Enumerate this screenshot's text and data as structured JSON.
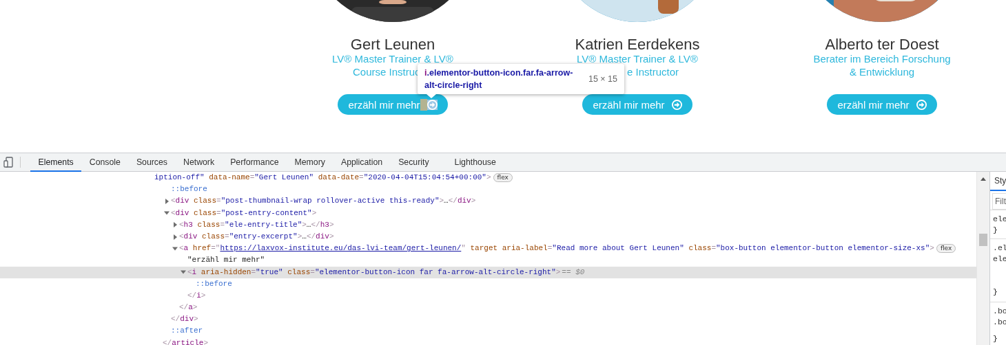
{
  "team": [
    {
      "name": "Gert Leunen",
      "role_lines": [
        {
          "text": "LV® Master Trainer & LV®",
          "kind": "whole"
        },
        {
          "text": "Course Instruc",
          "kind": "cut-end"
        }
      ],
      "button": {
        "label": "erzähl mir mehr",
        "inspected": true
      }
    },
    {
      "name": "Katrien Eerdekens",
      "role_lines": [
        {
          "text": "LV® Master Trainer & LV®",
          "kind": "whole"
        },
        {
          "text": "e Instructor",
          "kind": "cut-start"
        }
      ],
      "button": {
        "label": "erzähl mir mehr",
        "inspected": false
      }
    },
    {
      "name": "Alberto ter Doest",
      "role_lines": [
        {
          "text": "Berater im Bereich Forschung",
          "kind": "whole"
        },
        {
          "text": "& Entwicklung",
          "kind": "whole"
        }
      ],
      "button": {
        "label": "erzähl mir mehr",
        "inspected": false
      }
    }
  ],
  "tooltip": {
    "tag": "i",
    "selector": ".elementor-button-icon.far.fa-arrow-alt-circle-right",
    "size": "15 × 15"
  },
  "devtools": {
    "tabs": [
      {
        "label": "Elements",
        "selected": true
      },
      {
        "label": "Console",
        "selected": false
      },
      {
        "label": "Sources",
        "selected": false
      },
      {
        "label": "Network",
        "selected": false
      },
      {
        "label": "Performance",
        "selected": false
      },
      {
        "label": "Memory",
        "selected": false
      },
      {
        "label": "Application",
        "selected": false
      },
      {
        "label": "Security",
        "selected": false
      },
      {
        "label": "Lighthouse",
        "selected": false
      }
    ],
    "dom": {
      "wrapped": true,
      "selected": false,
      "badge": "flex",
      "tokens": [
        {
          "kind": "value",
          "text": "iption-off\""
        },
        {
          "kind": "attr",
          "text": " data-name"
        },
        {
          "kind": "punct",
          "text": "="
        },
        {
          "kind": "value",
          "text": "\"Gert Leunen\""
        },
        {
          "kind": "attr",
          "text": " data-date"
        },
        {
          "kind": "punct",
          "text": "="
        },
        {
          "kind": "value",
          "text": "\"2020-04-04T15:04:54+00:00\""
        },
        {
          "kind": "punct",
          "text": ">"
        }
      ],
      "children": [
        {
          "selected": false,
          "tokens": [
            {
              "kind": "pseudo",
              "text": "::before"
            }
          ]
        },
        {
          "selected": false,
          "expanded": false,
          "tokens": [
            {
              "kind": "punct",
              "text": "<"
            },
            {
              "kind": "tag",
              "text": "div"
            },
            {
              "kind": "attr",
              "text": " class"
            },
            {
              "kind": "punct",
              "text": "="
            },
            {
              "kind": "value",
              "text": "\"post-thumbnail-wrap rollover-active this-ready\""
            },
            {
              "kind": "punct",
              "text": ">"
            },
            {
              "kind": "text",
              "text": "…"
            },
            {
              "kind": "punct",
              "text": "</"
            },
            {
              "kind": "tag",
              "text": "div"
            },
            {
              "kind": "punct",
              "text": ">"
            }
          ]
        },
        {
          "selected": false,
          "expanded": true,
          "tokens": [
            {
              "kind": "punct",
              "text": "<"
            },
            {
              "kind": "tag",
              "text": "div"
            },
            {
              "kind": "attr",
              "text": " class"
            },
            {
              "kind": "punct",
              "text": "="
            },
            {
              "kind": "value",
              "text": "\"post-entry-content\""
            },
            {
              "kind": "punct",
              "text": ">"
            }
          ],
          "children": [
            {
              "selected": false,
              "expanded": false,
              "tokens": [
                {
                  "kind": "punct",
                  "text": "<"
                },
                {
                  "kind": "tag",
                  "text": "h3"
                },
                {
                  "kind": "attr",
                  "text": " class"
                },
                {
                  "kind": "punct",
                  "text": "="
                },
                {
                  "kind": "value",
                  "text": "\"ele-entry-title\""
                },
                {
                  "kind": "punct",
                  "text": ">"
                },
                {
                  "kind": "text",
                  "text": "…"
                },
                {
                  "kind": "punct",
                  "text": "</"
                },
                {
                  "kind": "tag",
                  "text": "h3"
                },
                {
                  "kind": "punct",
                  "text": ">"
                }
              ]
            },
            {
              "selected": false,
              "expanded": false,
              "tokens": [
                {
                  "kind": "punct",
                  "text": "<"
                },
                {
                  "kind": "tag",
                  "text": "div"
                },
                {
                  "kind": "attr",
                  "text": " class"
                },
                {
                  "kind": "punct",
                  "text": "="
                },
                {
                  "kind": "value",
                  "text": "\"entry-excerpt\""
                },
                {
                  "kind": "punct",
                  "text": ">"
                },
                {
                  "kind": "text",
                  "text": "…"
                },
                {
                  "kind": "punct",
                  "text": "</"
                },
                {
                  "kind": "tag",
                  "text": "div"
                },
                {
                  "kind": "punct",
                  "text": ">"
                }
              ]
            },
            {
              "selected": false,
              "expanded": true,
              "badge": "flex",
              "tokens": [
                {
                  "kind": "punct",
                  "text": "<"
                },
                {
                  "kind": "tag",
                  "text": "a"
                },
                {
                  "kind": "attr",
                  "text": " href"
                },
                {
                  "kind": "punct",
                  "text": "=\""
                },
                {
                  "kind": "link",
                  "text": "https://laxvox-institute.eu/das-lvi-team/gert-leunen/"
                },
                {
                  "kind": "punct",
                  "text": "\""
                },
                {
                  "kind": "attr",
                  "text": " target aria-label"
                },
                {
                  "kind": "punct",
                  "text": "="
                },
                {
                  "kind": "value",
                  "text": "\"Read more about Gert Leunen\""
                },
                {
                  "kind": "attr",
                  "text": " class"
                },
                {
                  "kind": "punct",
                  "text": "="
                },
                {
                  "kind": "value",
                  "text": "\"box-button elementor-button elementor-size-xs\""
                },
                {
                  "kind": "punct",
                  "text": ">"
                }
              ],
              "children": [
                {
                  "selected": false,
                  "tokens": [
                    {
                      "kind": "text",
                      "text": "\"erzähl mir mehr\""
                    }
                  ]
                },
                {
                  "selected": true,
                  "expanded": true,
                  "marker": "== $0",
                  "tokens": [
                    {
                      "kind": "punct",
                      "text": "<"
                    },
                    {
                      "kind": "tag",
                      "text": "i"
                    },
                    {
                      "kind": "attr",
                      "text": " aria-hidden"
                    },
                    {
                      "kind": "punct",
                      "text": "="
                    },
                    {
                      "kind": "value",
                      "text": "\"true\""
                    },
                    {
                      "kind": "attr",
                      "text": " class"
                    },
                    {
                      "kind": "punct",
                      "text": "="
                    },
                    {
                      "kind": "value",
                      "text": "\"elementor-button-icon far fa-arrow-alt-circle-right\""
                    },
                    {
                      "kind": "punct",
                      "text": ">"
                    }
                  ],
                  "children": [
                    {
                      "selected": false,
                      "tokens": [
                        {
                          "kind": "pseudo",
                          "text": "::before"
                        }
                      ]
                    }
                  ],
                  "close": [
                    {
                      "kind": "punct",
                      "text": "</"
                    },
                    {
                      "kind": "tag",
                      "text": "i"
                    },
                    {
                      "kind": "punct",
                      "text": ">"
                    }
                  ]
                }
              ],
              "close": [
                {
                  "kind": "punct",
                  "text": "</"
                },
                {
                  "kind": "tag",
                  "text": "a"
                },
                {
                  "kind": "punct",
                  "text": ">"
                }
              ]
            }
          ],
          "close": [
            {
              "kind": "punct",
              "text": "</"
            },
            {
              "kind": "tag",
              "text": "div"
            },
            {
              "kind": "punct",
              "text": ">"
            }
          ]
        },
        {
          "selected": false,
          "tokens": [
            {
              "kind": "pseudo",
              "text": "::after"
            }
          ]
        }
      ],
      "close": [
        {
          "kind": "punct",
          "text": "</"
        },
        {
          "kind": "tag",
          "text": "article"
        },
        {
          "kind": "punct",
          "text": ">"
        }
      ]
    },
    "styles_pane": {
      "tab": "Sty",
      "filter_placeholder": "Filt",
      "rules": [
        [
          "ele",
          "}"
        ],
        [
          ".el",
          "ele",
          "}"
        ],
        [
          ".bo",
          ".bo",
          "}"
        ]
      ]
    }
  }
}
